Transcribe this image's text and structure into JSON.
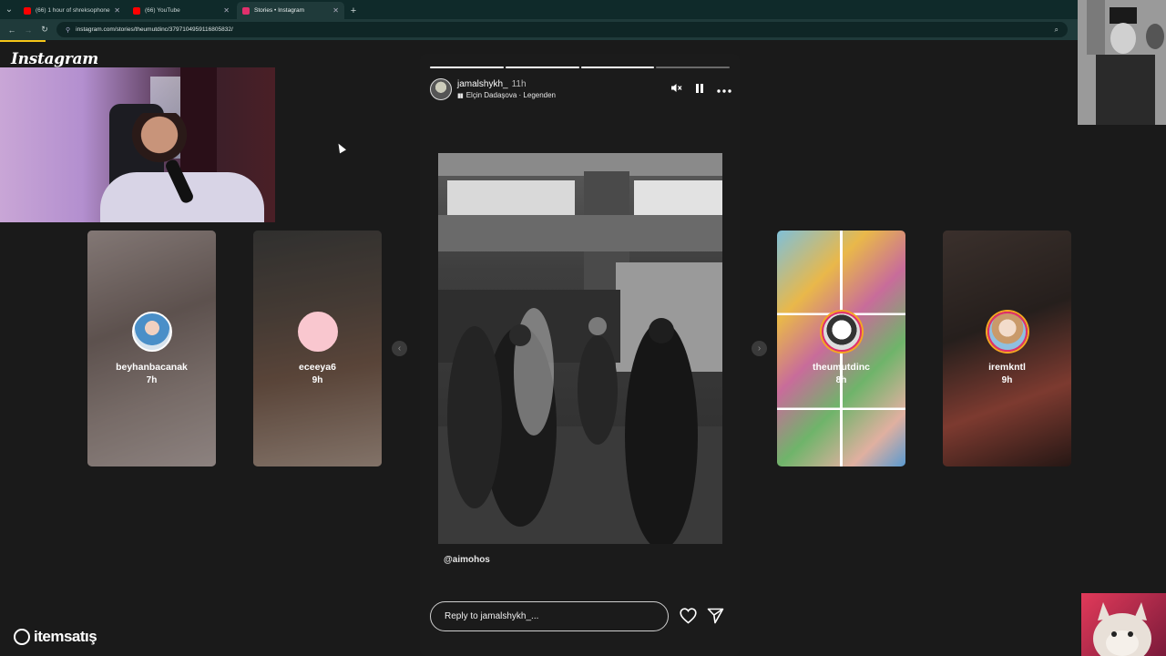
{
  "browser": {
    "tabs": [
      {
        "title": "(66) 1 hour of shreksophone - Y",
        "favicon_color": "#ff0000",
        "active": false
      },
      {
        "title": "(66) YouTube",
        "favicon_color": "#ff0000",
        "active": false
      },
      {
        "title": "Stories • Instagram",
        "favicon_color": "#e1306c",
        "active": true
      }
    ],
    "url": "instagram.com/stories/theumutdinc/3797104959116805832/"
  },
  "app": {
    "logo_text": "Instagram"
  },
  "side_stories": [
    {
      "username": "beyhanbacanak",
      "time": "7h"
    },
    {
      "username": "eceeya6",
      "time": "9h"
    },
    {
      "username": "theumutdinc",
      "time": "8h"
    },
    {
      "username": "iremkntl",
      "time": "9h"
    }
  ],
  "story": {
    "username": "jamalshykh_",
    "time": "11h",
    "music": "Elçin Dadaşova · Legenden",
    "progress_segments": [
      true,
      true,
      true,
      false
    ],
    "caption": "@aimohos",
    "reply_placeholder": "Reply to jamalshykh_..."
  },
  "watermark": {
    "text": "itemsatış"
  }
}
